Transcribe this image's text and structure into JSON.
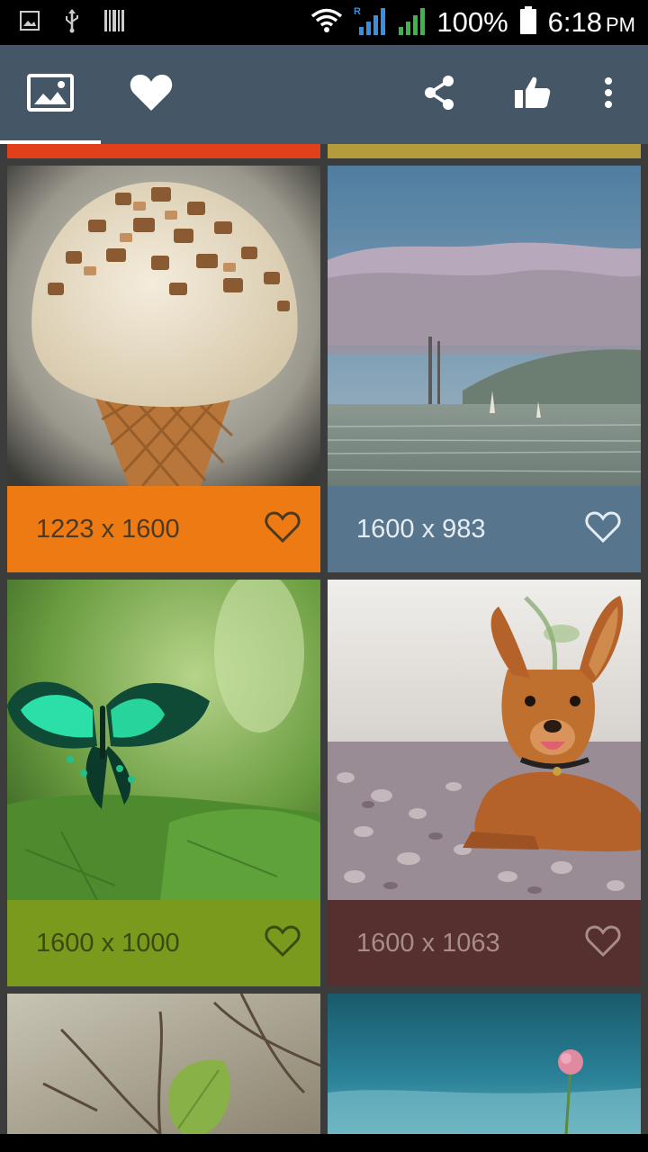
{
  "status_bar": {
    "battery_percent": "100%",
    "time": "6:18",
    "ampm": "PM",
    "icons": [
      "image-notification-icon",
      "usb-icon",
      "barcode-icon",
      "wifi-icon",
      "signal-roaming-icon",
      "signal-icon",
      "battery-icon"
    ]
  },
  "app_bar": {
    "tabs": [
      {
        "name": "gallery",
        "icon": "image-icon",
        "selected": true
      },
      {
        "name": "favorites",
        "icon": "heart-icon",
        "selected": false
      }
    ],
    "actions": [
      "share-icon",
      "thumbs-up-icon",
      "more-vert-icon"
    ],
    "colors": {
      "background": "#455767",
      "indicator": "#ffffff"
    }
  },
  "grid": {
    "peek_colors": [
      "#e2401a",
      "#b49b3c"
    ],
    "cards": [
      {
        "dims": "1223 x 1600",
        "subject": "ice-cream-cone",
        "caption_color": "#ee7a14",
        "text_color": "#4a3a22"
      },
      {
        "dims": "1600 x 983",
        "subject": "foggy-bay-bridge",
        "caption_color": "#57768e",
        "text_color": "#e6edf2"
      },
      {
        "dims": "1600 x 1000",
        "subject": "green-butterfly",
        "caption_color": "#7a9a1e",
        "text_color": "#3a4a10"
      },
      {
        "dims": "1600 x 1063",
        "subject": "puppy-on-pebbles",
        "caption_color": "#55302f",
        "text_color": "#a88c88"
      },
      {
        "dims": "",
        "subject": "leaf-on-branch",
        "caption_color": "",
        "text_color": ""
      },
      {
        "dims": "",
        "subject": "pink-flower-water",
        "caption_color": "",
        "text_color": ""
      }
    ]
  }
}
